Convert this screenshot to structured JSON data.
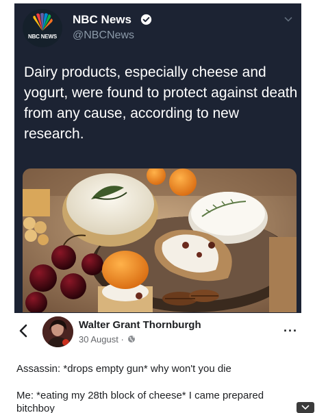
{
  "tweet": {
    "account_name": "NBC News",
    "handle": "@NBCNews",
    "logo_text": "NBC NEWS",
    "text": "Dairy products, especially cheese and yogurt, were found to protect against death from any cause, according to new research."
  },
  "comment": {
    "author": "Walter Grant Thornburgh",
    "date": "30 August ·",
    "line1": "Assassin: *drops empty gun* why won't you die",
    "line2": "Me: *eating my 28th block of cheese* I came prepared bitchboy"
  },
  "icons": {
    "verified": "verified-badge-icon",
    "chevron": "chevron-down-icon",
    "back": "back-arrow-icon",
    "globe": "globe-icon",
    "more": "more-options-icon"
  },
  "colors": {
    "tweet_bg": "#1c2333",
    "verified": "#1da1f2",
    "meta": "#65676b"
  }
}
